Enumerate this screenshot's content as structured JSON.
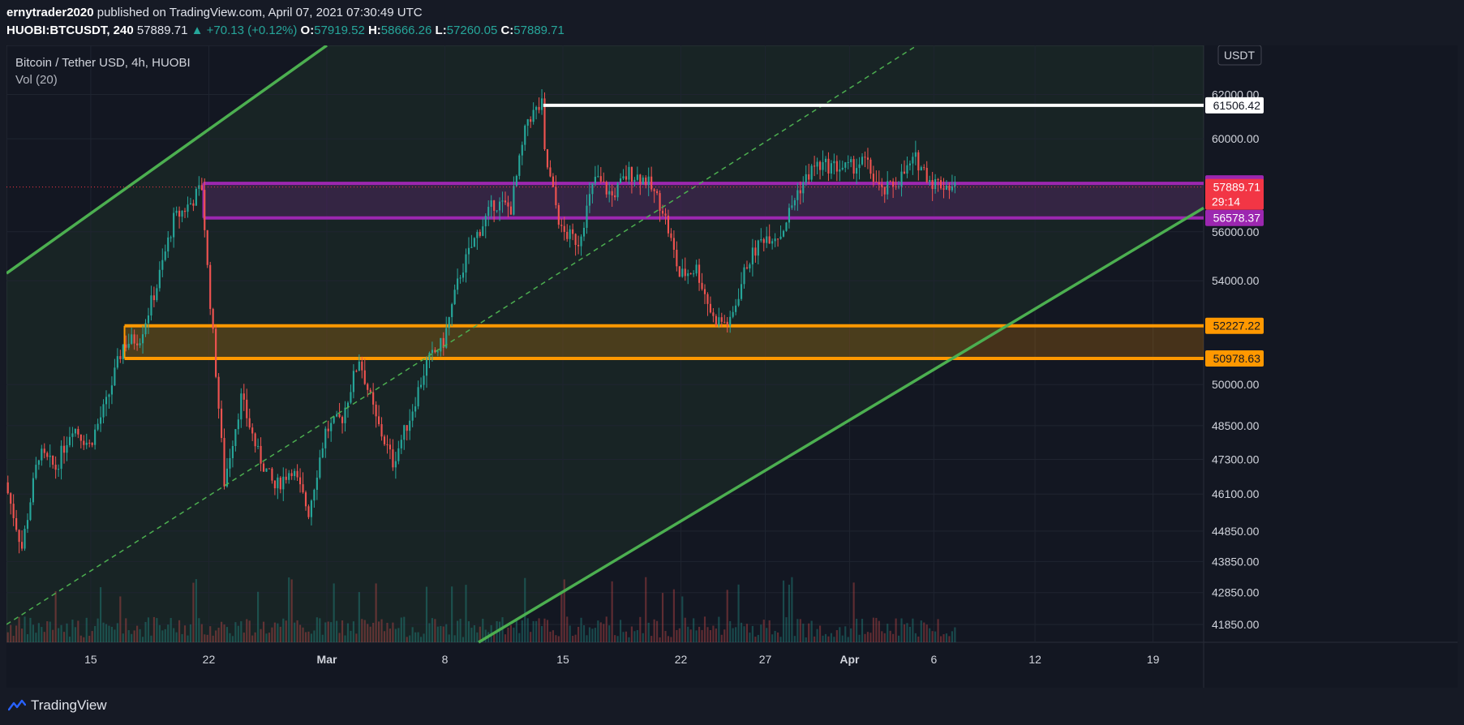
{
  "header": {
    "author": "ernytrader2020",
    "published_text": "published on TradingView.com, April 07, 2021 07:30:49 UTC",
    "symbol": "HUOBI:BTCUSDT, 240",
    "last": "57889.71",
    "change": "▲ +70.13 (+0.12%)",
    "o_label": "O:",
    "o_value": "57919.52",
    "h_label": "H:",
    "h_value": "58666.26",
    "l_label": "L:",
    "l_value": "57260.05",
    "c_label": "C:",
    "c_value": "57889.71"
  },
  "legend": {
    "title": "Bitcoin / Tether USD, 4h, HUOBI",
    "volume": "Vol (20)"
  },
  "currency_button": "USDT",
  "footer": {
    "brand": "TradingView"
  },
  "colors": {
    "background": "#161a25",
    "up": "#26a69a",
    "down": "#ef5350",
    "channel": "#4caf50",
    "purple_zone": "#9c27b0",
    "orange_zone": "#ff9800",
    "resistance_line": "#ffffff",
    "current_price": "#f23645"
  },
  "chart_data": {
    "type": "candlestick",
    "title": "Bitcoin / Tether USD, 4h, HUOBI",
    "interval": "4h",
    "x_ticks": [
      {
        "label": "15",
        "date": "2021-02-15"
      },
      {
        "label": "22",
        "date": "2021-02-22"
      },
      {
        "label": "Mar",
        "date": "2021-03-01"
      },
      {
        "label": "8",
        "date": "2021-03-08"
      },
      {
        "label": "15",
        "date": "2021-03-15"
      },
      {
        "label": "22",
        "date": "2021-03-22"
      },
      {
        "label": "27",
        "date": "2021-03-27"
      },
      {
        "label": "Apr",
        "date": "2021-04-01"
      },
      {
        "label": "6",
        "date": "2021-04-06"
      },
      {
        "label": "12",
        "date": "2021-04-12"
      },
      {
        "label": "19",
        "date": "2021-04-19"
      }
    ],
    "y_scale": "log",
    "y_ticks": [
      {
        "label": "62000.00",
        "value": 62000
      },
      {
        "label": "60000.00",
        "value": 60000
      },
      {
        "label": "56000.00",
        "value": 56000
      },
      {
        "label": "54000.00",
        "value": 54000
      },
      {
        "label": "50000.00",
        "value": 50000
      },
      {
        "label": "48500.00",
        "value": 48500
      },
      {
        "label": "47300.00",
        "value": 47300
      },
      {
        "label": "46100.00",
        "value": 46100
      },
      {
        "label": "44850.00",
        "value": 44850
      },
      {
        "label": "43850.00",
        "value": 43850
      },
      {
        "label": "42850.00",
        "value": 42850
      },
      {
        "label": "41850.00",
        "value": 41850
      }
    ],
    "y_range": [
      41300,
      64300
    ],
    "x_range": [
      "2021-02-10",
      "2021-04-22"
    ],
    "price_path": [
      [
        "2021-02-10",
        46500
      ],
      [
        "2021-02-11",
        44300
      ],
      [
        "2021-02-12",
        47500
      ],
      [
        "2021-02-13",
        47000
      ],
      [
        "2021-02-14",
        48500
      ],
      [
        "2021-02-15",
        47800
      ],
      [
        "2021-02-16",
        49300
      ],
      [
        "2021-02-17",
        51500
      ],
      [
        "2021-02-18",
        51800
      ],
      [
        "2021-02-19",
        53800
      ],
      [
        "2021-02-20",
        56500
      ],
      [
        "2021-02-21",
        57200
      ],
      [
        "2021-02-21T16:00",
        57900
      ],
      [
        "2021-02-22",
        54500
      ],
      [
        "2021-02-22T18:00",
        48500
      ],
      [
        "2021-02-23",
        46500
      ],
      [
        "2021-02-24",
        49500
      ],
      [
        "2021-02-25",
        47500
      ],
      [
        "2021-02-26",
        46300
      ],
      [
        "2021-02-27",
        47000
      ],
      [
        "2021-02-28",
        45500
      ],
      [
        "2021-03-01",
        48300
      ],
      [
        "2021-03-02",
        48800
      ],
      [
        "2021-03-03",
        51000
      ],
      [
        "2021-03-04",
        48700
      ],
      [
        "2021-03-05",
        47200
      ],
      [
        "2021-03-06",
        48800
      ],
      [
        "2021-03-07",
        50800
      ],
      [
        "2021-03-08",
        51600
      ],
      [
        "2021-03-09",
        54300
      ],
      [
        "2021-03-10",
        55900
      ],
      [
        "2021-03-11",
        57200
      ],
      [
        "2021-03-12",
        57000
      ],
      [
        "2021-03-13",
        60900
      ],
      [
        "2021-03-13T20:00",
        61500
      ],
      [
        "2021-03-14",
        59300
      ],
      [
        "2021-03-15",
        56000
      ],
      [
        "2021-03-16",
        55600
      ],
      [
        "2021-03-17",
        58300
      ],
      [
        "2021-03-18",
        57500
      ],
      [
        "2021-03-19",
        58500
      ],
      [
        "2021-03-20",
        58200
      ],
      [
        "2021-03-21",
        57000
      ],
      [
        "2021-03-22",
        54200
      ],
      [
        "2021-03-23",
        54500
      ],
      [
        "2021-03-24",
        52500
      ],
      [
        "2021-03-25",
        52300
      ],
      [
        "2021-03-26",
        54700
      ],
      [
        "2021-03-27",
        55800
      ],
      [
        "2021-03-28",
        55900
      ],
      [
        "2021-03-29",
        57700
      ],
      [
        "2021-03-30",
        58800
      ],
      [
        "2021-03-31",
        58800
      ],
      [
        "2021-04-01",
        58700
      ],
      [
        "2021-04-02",
        59000
      ],
      [
        "2021-04-03",
        57600
      ],
      [
        "2021-04-04",
        58200
      ],
      [
        "2021-04-05",
        59100
      ],
      [
        "2021-04-06",
        58100
      ],
      [
        "2021-04-07T08:00",
        57890
      ]
    ],
    "zones": [
      {
        "name": "purple",
        "high": 58047.83,
        "low": 56578.37,
        "from": "2021-02-21T16:00",
        "high_label": "58047.83",
        "low_label": "56578.37"
      },
      {
        "name": "orange",
        "high": 52227.22,
        "low": 50978.63,
        "from": "2021-02-17",
        "high_label": "52227.22",
        "low_label": "50978.63"
      }
    ],
    "resistance": {
      "value": 61506.42,
      "label": "61506.42",
      "from": "2021-03-13T20:00"
    },
    "current_price": {
      "value": 57889.71,
      "label": "57889.71",
      "countdown": "29:14"
    },
    "channel": {
      "upper": [
        [
          "2021-02-10",
          54300
        ],
        [
          "2021-02-21T16:00",
          58000
        ],
        [
          "2021-03-01",
          64300
        ]
      ],
      "lower": [
        [
          "2021-03-10",
          41300
        ],
        [
          "2021-04-22",
          57000
        ]
      ],
      "mid_dashed": [
        [
          "2021-02-10",
          41850
        ],
        [
          "2021-04-05",
          64300
        ]
      ]
    },
    "volume_indicator": "Vol (20)"
  }
}
